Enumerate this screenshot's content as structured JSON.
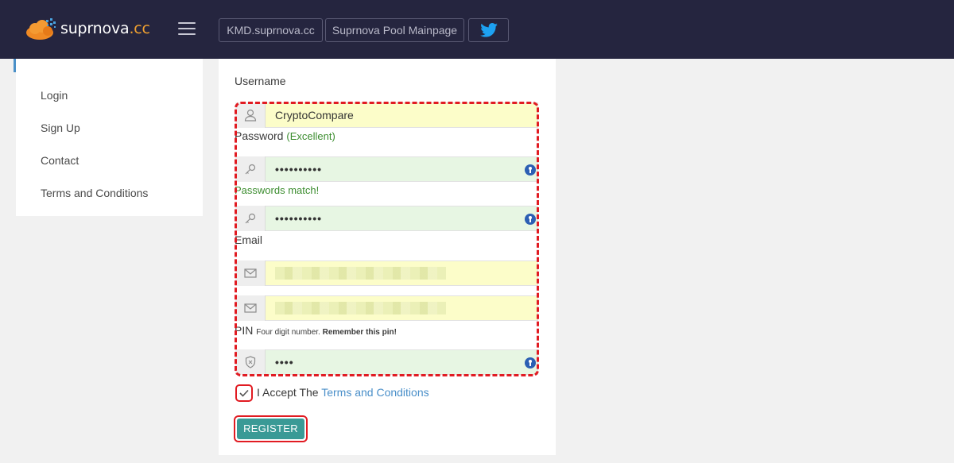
{
  "header": {
    "logo_text": "suprnova",
    "logo_tld": ".cc",
    "nav_buttons": [
      "KMD.suprnova.cc",
      "Suprnova Pool Mainpage"
    ],
    "twitter_icon": "twitter-bird-icon",
    "menu_icon": "hamburger-icon"
  },
  "sidebar": {
    "items": [
      {
        "label": "Login"
      },
      {
        "label": "Sign Up"
      },
      {
        "label": "Contact"
      },
      {
        "label": "Terms and Conditions"
      }
    ]
  },
  "form": {
    "username_label": "Username",
    "username_value": "CryptoCompare",
    "password_label": "Password",
    "password_strength": "(Excellent)",
    "password_dots": "••••••••••",
    "password_match_msg": "Passwords match!",
    "confirm_dots": "••••••••••",
    "email_label": "Email",
    "pin_label": "PIN",
    "pin_hint": "Four digit number.",
    "pin_hint_bold": "Remember this pin!",
    "pin_dots": "••••",
    "accept_text": "I Accept The",
    "terms_link": "Terms and Conditions",
    "register_label": "REGISTER"
  },
  "colors": {
    "topbar": "#25253f",
    "accent_teal": "#3a9a96",
    "highlight_red": "#e11b22",
    "link_blue": "#4a8fc9",
    "success_green": "#3c8d2f"
  }
}
